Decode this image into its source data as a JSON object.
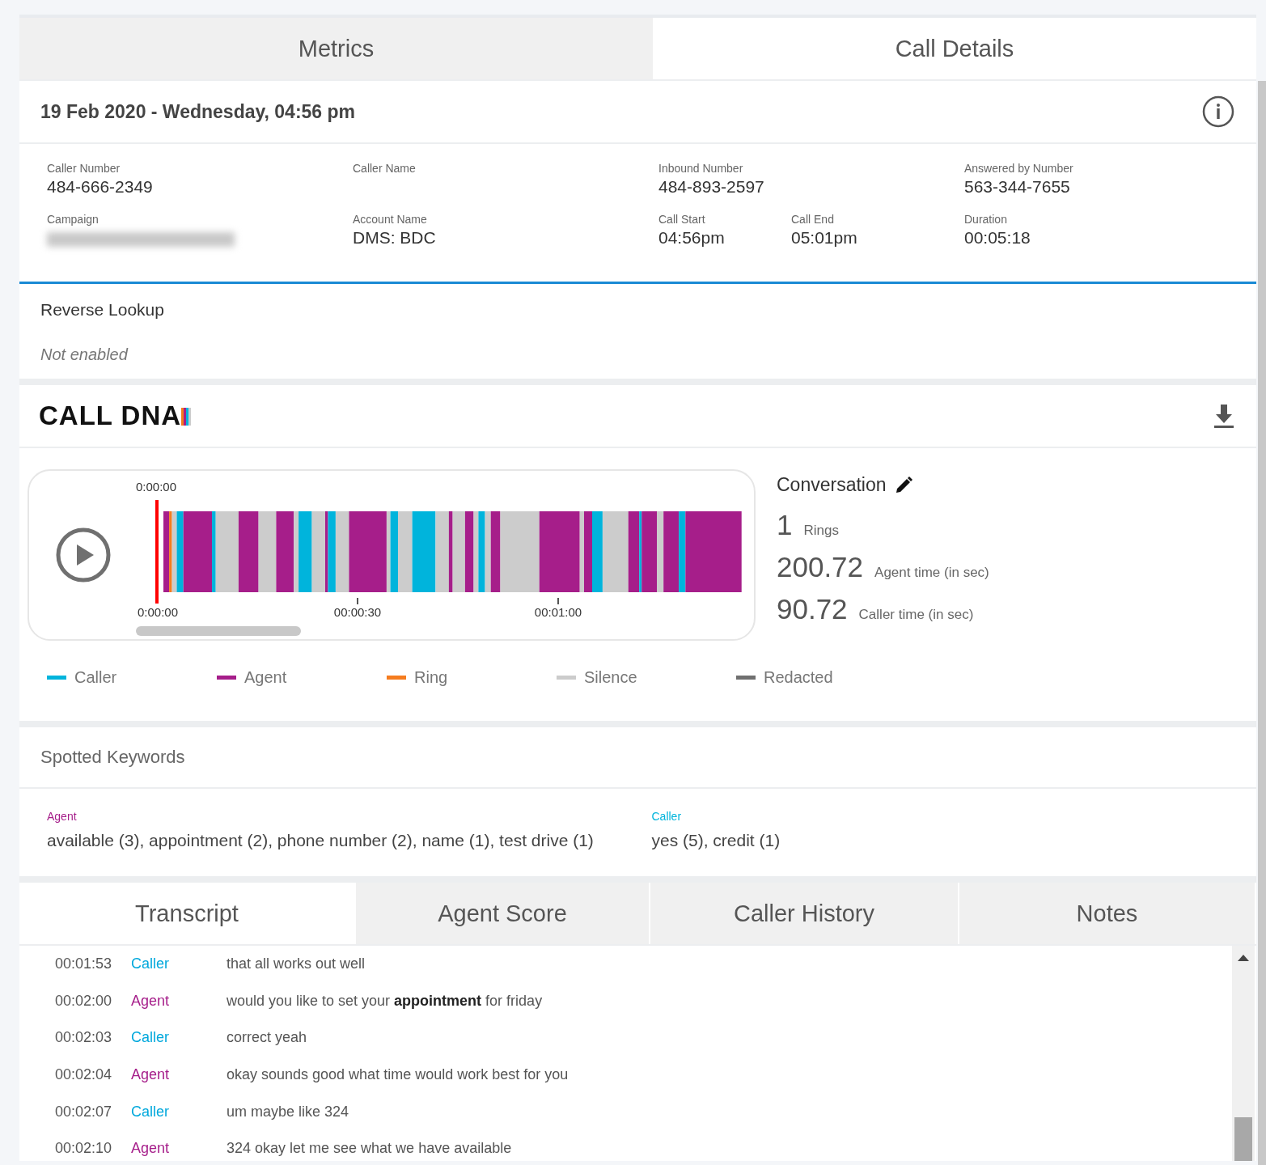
{
  "top_tabs": [
    {
      "label": "Metrics",
      "selected": false
    },
    {
      "label": "Call Details",
      "selected": true
    }
  ],
  "call_header": {
    "title": "19 Feb 2020 - Wednesday, 04:56 pm"
  },
  "details": {
    "rows": [
      [
        {
          "fields": [
            {
              "label": "Caller Number",
              "value": "484-666-2349",
              "kind": "text"
            }
          ]
        },
        {
          "fields": [
            {
              "label": "Caller Name",
              "kind": "text"
            }
          ]
        },
        {
          "fields": [
            {
              "label": "Inbound Number",
              "value": "484-893-2597",
              "kind": "text"
            }
          ]
        },
        {
          "fields": [
            {
              "label": "Answered by Number",
              "value": "563-344-7655",
              "kind": "text"
            }
          ]
        }
      ],
      [
        {
          "fields": [
            {
              "label": "Campaign",
              "kind": "blurred"
            }
          ]
        },
        {
          "fields": [
            {
              "label": "Account Name",
              "value": "DMS: BDC",
              "kind": "text"
            }
          ]
        },
        {
          "fields": [
            {
              "label": "Call Start",
              "value": "04:56pm",
              "kind": "text"
            },
            {
              "label": "Call End",
              "value": "05:01pm",
              "kind": "text"
            }
          ]
        },
        {
          "fields": [
            {
              "label": "Duration",
              "value": "00:05:18",
              "kind": "text"
            }
          ]
        }
      ]
    ]
  },
  "reverse_lookup": {
    "title": "Reverse Lookup",
    "status": "Not enabled"
  },
  "call_dna": {
    "title": "CALL DNA",
    "player": {
      "playhead_time": "0:00:00",
      "ticks": [
        "0:00:00",
        "00:00:30",
        "00:01:00"
      ]
    },
    "conversation": {
      "title": "Conversation",
      "stats": [
        {
          "value": "1",
          "label": "Rings"
        },
        {
          "value": "200.72",
          "label": "Agent time (in sec)"
        },
        {
          "value": "90.72",
          "label": "Caller time (in sec)"
        }
      ]
    },
    "legend": [
      {
        "label": "Caller",
        "color": "#00b4dc"
      },
      {
        "label": "Agent",
        "color": "#a61e8a"
      },
      {
        "label": "Ring",
        "color": "#f57c1f"
      },
      {
        "label": "Silence",
        "color": "#cccccc"
      },
      {
        "label": "Redacted",
        "color": "#707070"
      }
    ]
  },
  "spotted_keywords": {
    "title": "Spotted Keywords",
    "groups": [
      {
        "label": "Agent",
        "color": "#a61e8a",
        "keywords": "available (3), appointment (2), phone number (2), name (1), test drive (1)"
      },
      {
        "label": "Caller",
        "color": "#00b4dc",
        "keywords": "yes (5), credit (1)"
      }
    ]
  },
  "bottom_tabs": [
    {
      "label": "Transcript",
      "selected": true
    },
    {
      "label": "Agent Score",
      "selected": false
    },
    {
      "label": "Caller History",
      "selected": false
    },
    {
      "label": "Notes",
      "selected": false
    }
  ],
  "transcript": [
    {
      "time": "00:01:53",
      "speaker": "Caller",
      "kind": "caller",
      "text": "that all works out well"
    },
    {
      "time": "00:02:00",
      "speaker": "Agent",
      "kind": "agent",
      "text": "would you like to set your **appointment** for friday"
    },
    {
      "time": "00:02:03",
      "speaker": "Caller",
      "kind": "caller",
      "text": "correct yeah"
    },
    {
      "time": "00:02:04",
      "speaker": "Agent",
      "kind": "agent",
      "text": "okay sounds good what time would work best for you"
    },
    {
      "time": "00:02:07",
      "speaker": "Caller",
      "kind": "caller",
      "text": "um maybe like 324"
    },
    {
      "time": "00:02:10",
      "speaker": "Agent",
      "kind": "agent",
      "text": "324 okay let me see what we have available"
    }
  ]
}
